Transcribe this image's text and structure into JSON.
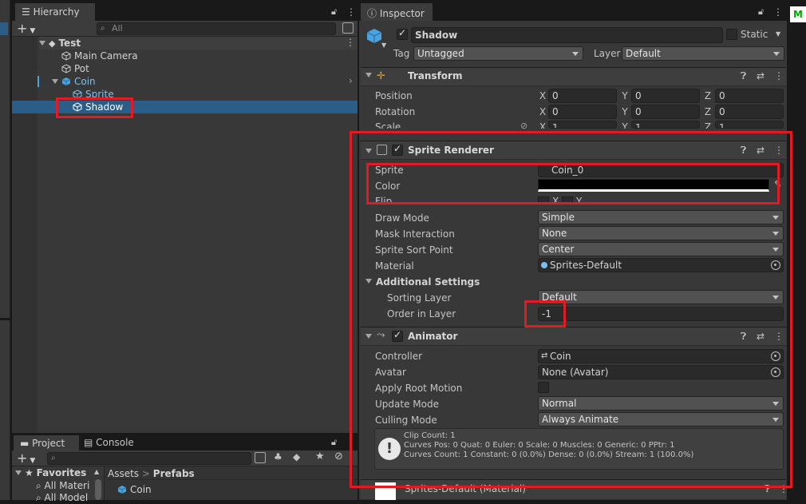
{
  "hierarchy": {
    "tab_label": "Hierarchy",
    "search_placeholder": "All",
    "scene": "Test",
    "items": [
      "Main Camera",
      "Pot",
      "Coin",
      "Sprite",
      "Shadow"
    ]
  },
  "inspector": {
    "tab_label": "Inspector",
    "object_name": "Shadow",
    "static_label": "Static",
    "tag_label": "Tag",
    "tag_value": "Untagged",
    "layer_label": "Layer",
    "layer_value": "Default",
    "transform": {
      "title": "Transform",
      "position_label": "Position",
      "rotation_label": "Rotation",
      "scale_label": "Scale",
      "axis_x": "X",
      "axis_y": "Y",
      "axis_z": "Z",
      "position": [
        "0",
        "0",
        "0"
      ],
      "rotation": [
        "0",
        "0",
        "0"
      ],
      "scale": [
        "1",
        "1",
        "1"
      ]
    },
    "sprite_renderer": {
      "title": "Sprite Renderer",
      "sprite_label": "Sprite",
      "sprite_value": "Coin_0",
      "color_label": "Color",
      "flip_label": "Flip",
      "flip_x": "X",
      "flip_y": "Y",
      "draw_mode_label": "Draw Mode",
      "draw_mode_value": "Simple",
      "mask_label": "Mask Interaction",
      "mask_value": "None",
      "sort_point_label": "Sprite Sort Point",
      "sort_point_value": "Center",
      "material_label": "Material",
      "material_value": "Sprites-Default",
      "additional_label": "Additional Settings",
      "sorting_layer_label": "Sorting Layer",
      "sorting_layer_value": "Default",
      "order_label": "Order in Layer",
      "order_value": "-1"
    },
    "animator": {
      "title": "Animator",
      "controller_label": "Controller",
      "controller_value": "Coin",
      "avatar_label": "Avatar",
      "avatar_value": "None (Avatar)",
      "root_motion_label": "Apply Root Motion",
      "update_label": "Update Mode",
      "update_value": "Normal",
      "culling_label": "Culling Mode",
      "culling_value": "Always Animate",
      "info_line1": "Clip Count: 1",
      "info_line2": "Curves Pos: 0 Quat: 0 Euler: 0 Scale: 0 Muscles: 0 Generic: 0 PPtr: 1",
      "info_line3": "Curves Count: 1 Constant: 0 (0.0%) Dense: 0 (0.0%) Stream: 1 (100.0%)"
    },
    "material_footer": "Sprites-Default (Material)"
  },
  "project": {
    "project_tab": "Project",
    "console_tab": "Console",
    "favorites_label": "Favorites",
    "favorites": [
      "All Materi",
      "All Model"
    ],
    "breadcrumb_root": "Assets",
    "breadcrumb_sep": ">",
    "breadcrumb_leaf": "Prefabs",
    "assets": [
      "Coin"
    ]
  },
  "colors": {
    "selection": "#2c5d87",
    "highlight": "#e01b24",
    "accent": "#4aa3df"
  }
}
